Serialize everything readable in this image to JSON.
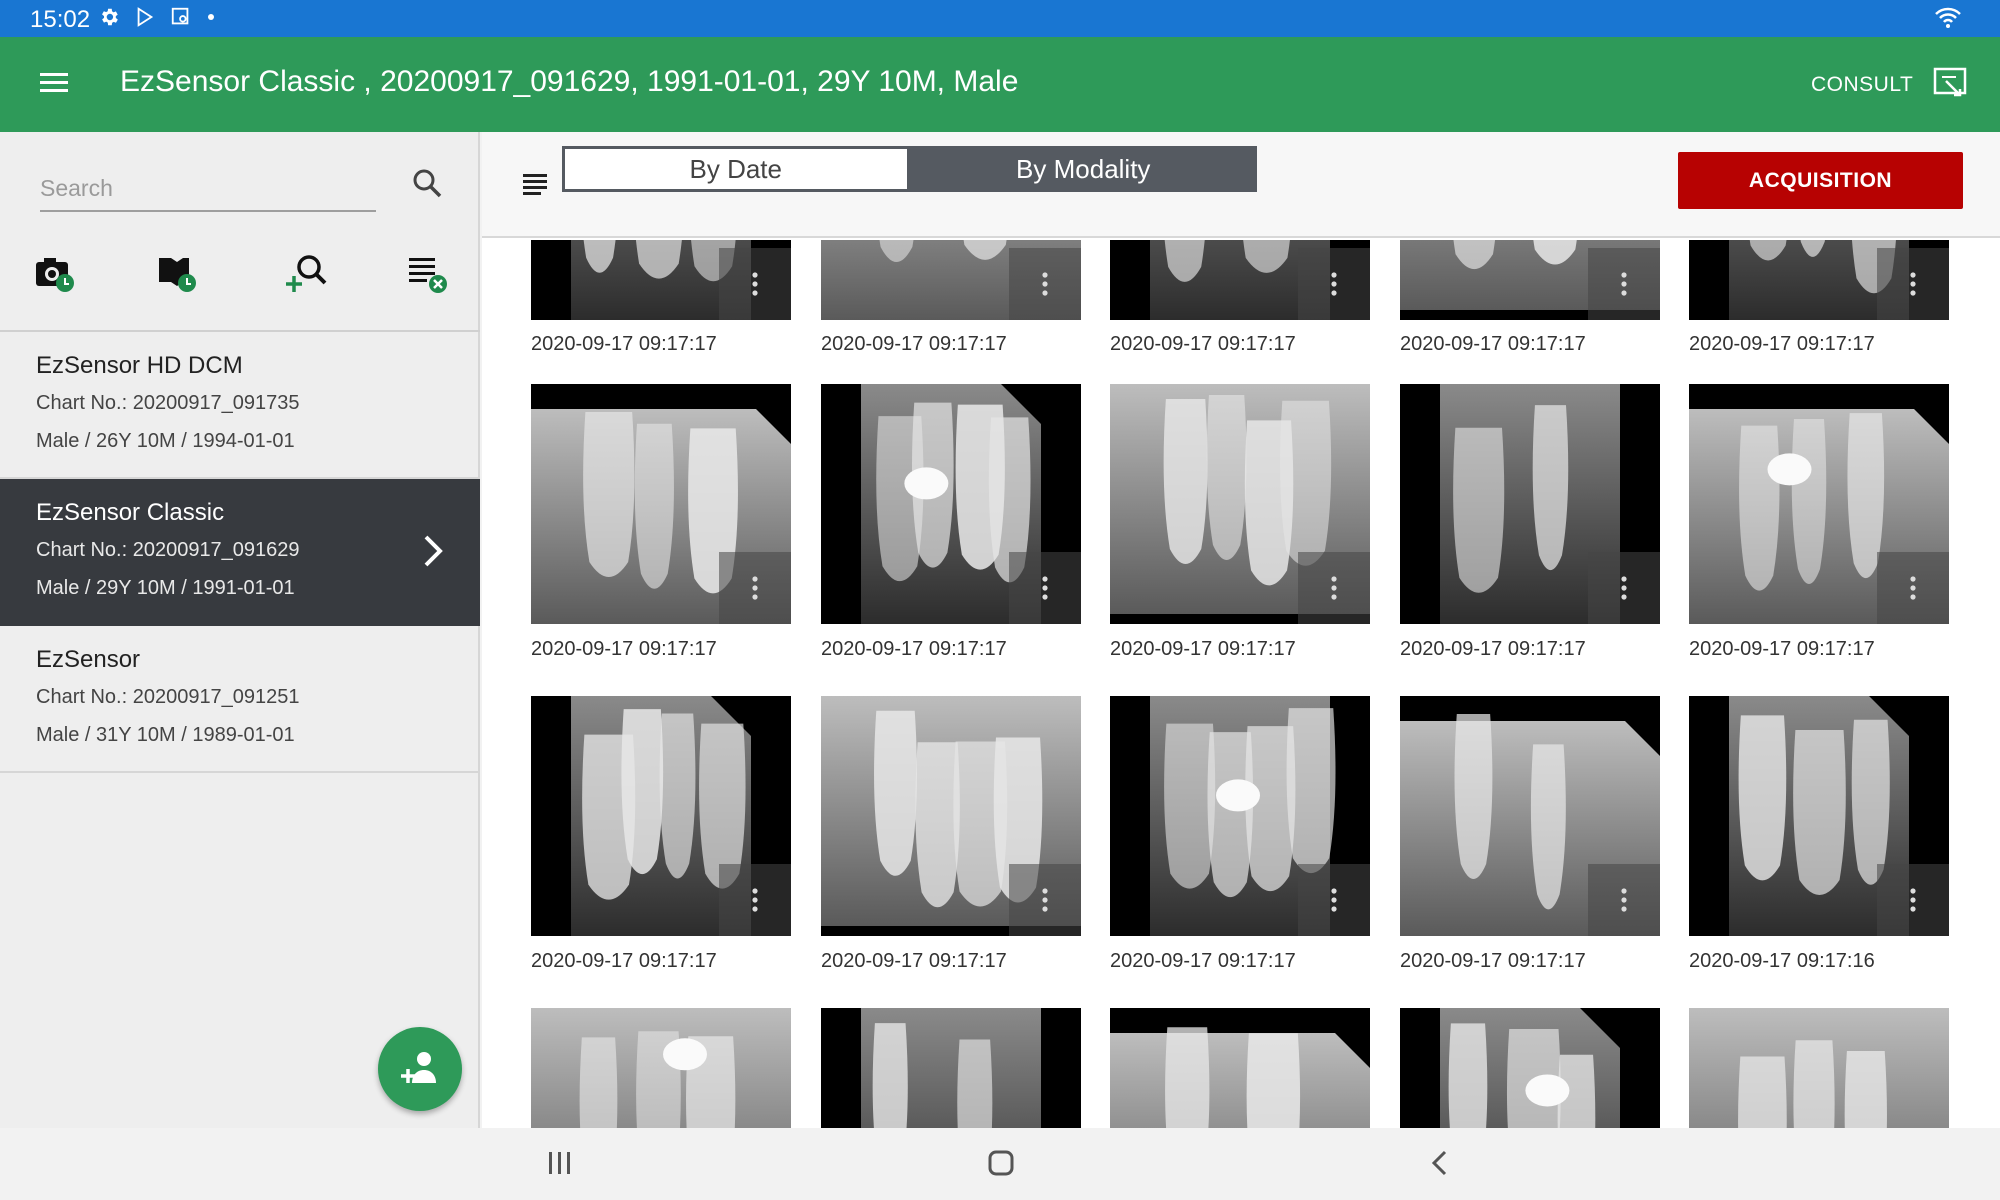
{
  "status_bar": {
    "time": "15:02",
    "icons": [
      "gear-icon",
      "play-store-icon",
      "screenshot-icon",
      "dot-icon"
    ],
    "right_icons": [
      "wifi-icon"
    ]
  },
  "app_bar": {
    "title": "EzSensor Classic , 20200917_091629, 1991-01-01, 29Y 10M, Male",
    "consult_label": "CONSULT",
    "color": "#2e9a59"
  },
  "sidebar": {
    "search_placeholder": "Search",
    "tools": [
      "camera-clock-icon",
      "book-clock-icon",
      "add-search-icon",
      "list-clear-icon"
    ],
    "patients": [
      {
        "name": "EzSensor HD DCM",
        "chart": "Chart No.:  20200917_091735",
        "info": "Male / 26Y 10M / 1994-01-01",
        "selected": false
      },
      {
        "name": "EzSensor Classic",
        "chart": "Chart No.:  20200917_091629",
        "info": "Male / 29Y 10M / 1991-01-01",
        "selected": true
      },
      {
        "name": "EzSensor",
        "chart": "Chart No.:  20200917_091251",
        "info": "Male / 31Y 10M / 1989-01-01",
        "selected": false
      }
    ]
  },
  "toolbar": {
    "seg_by_date": "By Date",
    "seg_by_modality": "By Modality",
    "active_seg": "By Modality",
    "acquisition_label": "ACQUISITION",
    "acquisition_color": "#b70202"
  },
  "images": {
    "row1": [
      "2020-09-17 09:17:17",
      "2020-09-17 09:17:17",
      "2020-09-17 09:17:17",
      "2020-09-17 09:17:17",
      "2020-09-17 09:17:17"
    ],
    "row2": [
      "2020-09-17 09:17:17",
      "2020-09-17 09:17:17",
      "2020-09-17 09:17:17",
      "2020-09-17 09:17:17",
      "2020-09-17 09:17:17"
    ],
    "row3": [
      "2020-09-17 09:17:17",
      "2020-09-17 09:17:17",
      "2020-09-17 09:17:17",
      "2020-09-17 09:17:17",
      "2020-09-17 09:17:16"
    ]
  }
}
